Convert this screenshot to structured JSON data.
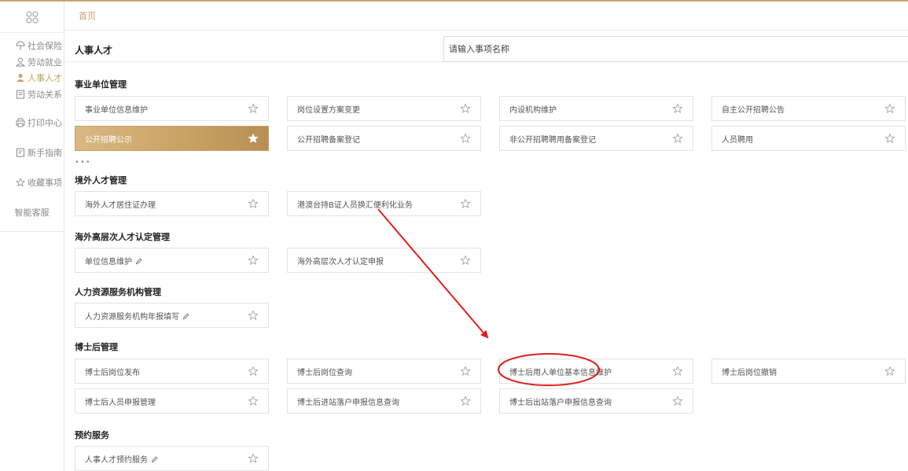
{
  "sidebar": {
    "items": [
      {
        "label": "社会保险",
        "icon": "umbrella-icon"
      },
      {
        "label": "劳动就业",
        "icon": "person-icon"
      },
      {
        "label": "人事人才",
        "icon": "person-icon",
        "active": true
      },
      {
        "label": "劳动关系",
        "icon": "document-icon"
      }
    ],
    "items2": [
      {
        "label": "打印中心",
        "icon": "printer-icon"
      },
      {
        "label": "新手指南",
        "icon": "document-icon"
      },
      {
        "label": "收藏事项",
        "icon": "star-icon"
      },
      {
        "label": "智能客服",
        "icon": ""
      }
    ]
  },
  "tabs": {
    "home": "首页"
  },
  "header": {
    "title": "人事人才"
  },
  "search": {
    "placeholder": "请输入事项名称"
  },
  "sections": [
    {
      "title": "事业单位管理",
      "rows": [
        [
          "事业单位信息维护",
          "岗位设置方案变更",
          "内设机构维护",
          "自主公开招聘公告"
        ],
        [
          "公开招聘公示",
          "公开招聘备案登记",
          "非公开招聘聘用备案登记",
          "人员聘用"
        ]
      ],
      "more": "•••"
    },
    {
      "title": "境外人才管理",
      "rows": [
        [
          "海外人才居住证办理",
          "港澳台持B证人员换汇便利化业务"
        ]
      ]
    },
    {
      "title": "海外高层次人才认定管理",
      "rows": [
        [
          "单位信息维护",
          "海外高层次人才认定申报"
        ]
      ]
    },
    {
      "title": "人力资源服务机构管理",
      "rows": [
        [
          "人力资源服务机构年报填写"
        ]
      ]
    },
    {
      "title": "博士后管理",
      "rows": [
        [
          "博士后岗位发布",
          "博士后岗位查询",
          "博士后用人单位基本信息维护",
          "博士后岗位撤销"
        ],
        [
          "博士后人员申报管理",
          "博士后进站落户申报信息查询",
          "博士后出站落户申报信息查询"
        ]
      ]
    },
    {
      "title": "预约服务",
      "rows": [
        [
          "人事人才预约服务"
        ]
      ]
    }
  ],
  "colors": {
    "accent": "#c9a063",
    "annotation": "#e0201c"
  }
}
